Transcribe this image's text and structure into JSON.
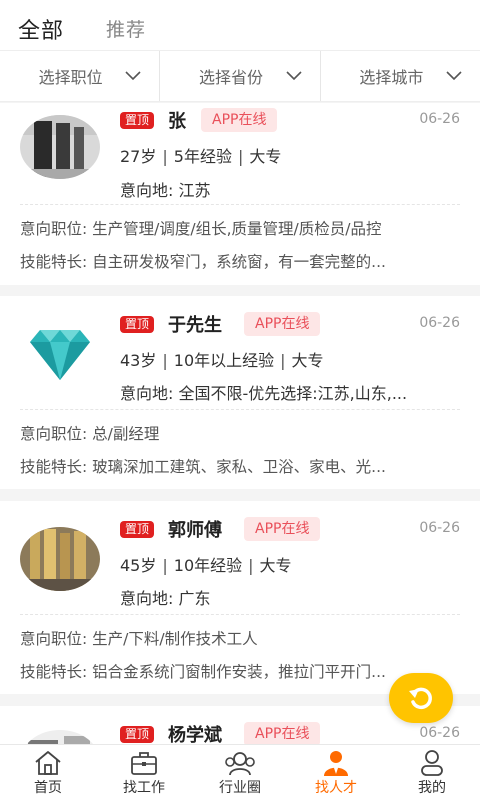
{
  "header": {
    "tabs": [
      {
        "label": "全部",
        "active": true
      },
      {
        "label": "推荐",
        "active": false
      }
    ]
  },
  "filters": [
    {
      "label": "选择职位"
    },
    {
      "label": "选择省份"
    },
    {
      "label": "选择城市"
    }
  ],
  "cards": [
    {
      "top_badge": "置顶",
      "name": "张",
      "status": "APP在线",
      "date": "06-26",
      "age": "27岁",
      "experience": "5年经验",
      "education": "大专",
      "intended_place": "意向地: 江苏",
      "intended_position": "意向职位: 生产管理/调度/组长,质量管理/质检员/品控",
      "skills": "技能特长: 自主研发极窄门，系统窗，有一套完整的..."
    },
    {
      "top_badge": "置顶",
      "name": "于先生",
      "status": "APP在线",
      "date": "06-26",
      "age": "43岁",
      "experience": "10年以上经验",
      "education": "大专",
      "intended_place": "意向地: 全国不限-优先选择:江苏,山东,...",
      "intended_position": "意向职位: 总/副经理",
      "skills": "技能特长: 玻璃深加工建筑、家私、卫浴、家电、光..."
    },
    {
      "top_badge": "置顶",
      "name": "郭师傅",
      "status": "APP在线",
      "date": "06-26",
      "age": "45岁",
      "experience": "10年经验",
      "education": "大专",
      "intended_place": "意向地: 广东",
      "intended_position": "意向职位: 生产/下料/制作技术工人",
      "skills": "技能特长: 铝合金系统门窗制作安装，推拉门平开门..."
    },
    {
      "top_badge": "置顶",
      "name": "杨学斌",
      "status": "APP在线",
      "date": "06-26"
    }
  ],
  "fab": {
    "icon": "refresh-icon",
    "color": "#ffc400"
  },
  "tabbar": {
    "items": [
      {
        "label": "首页",
        "icon": "home-icon",
        "active": false
      },
      {
        "label": "找工作",
        "icon": "briefcase-icon",
        "active": false
      },
      {
        "label": "行业圈",
        "icon": "community-icon",
        "active": false
      },
      {
        "label": "找人才",
        "icon": "talent-icon",
        "active": true
      },
      {
        "label": "我的",
        "icon": "person-icon",
        "active": false
      }
    ]
  },
  "colors": {
    "accent": "#ff6a00",
    "badge_red": "#e02020",
    "online_bg": "#fde6e6",
    "online_text": "#e9505a"
  }
}
